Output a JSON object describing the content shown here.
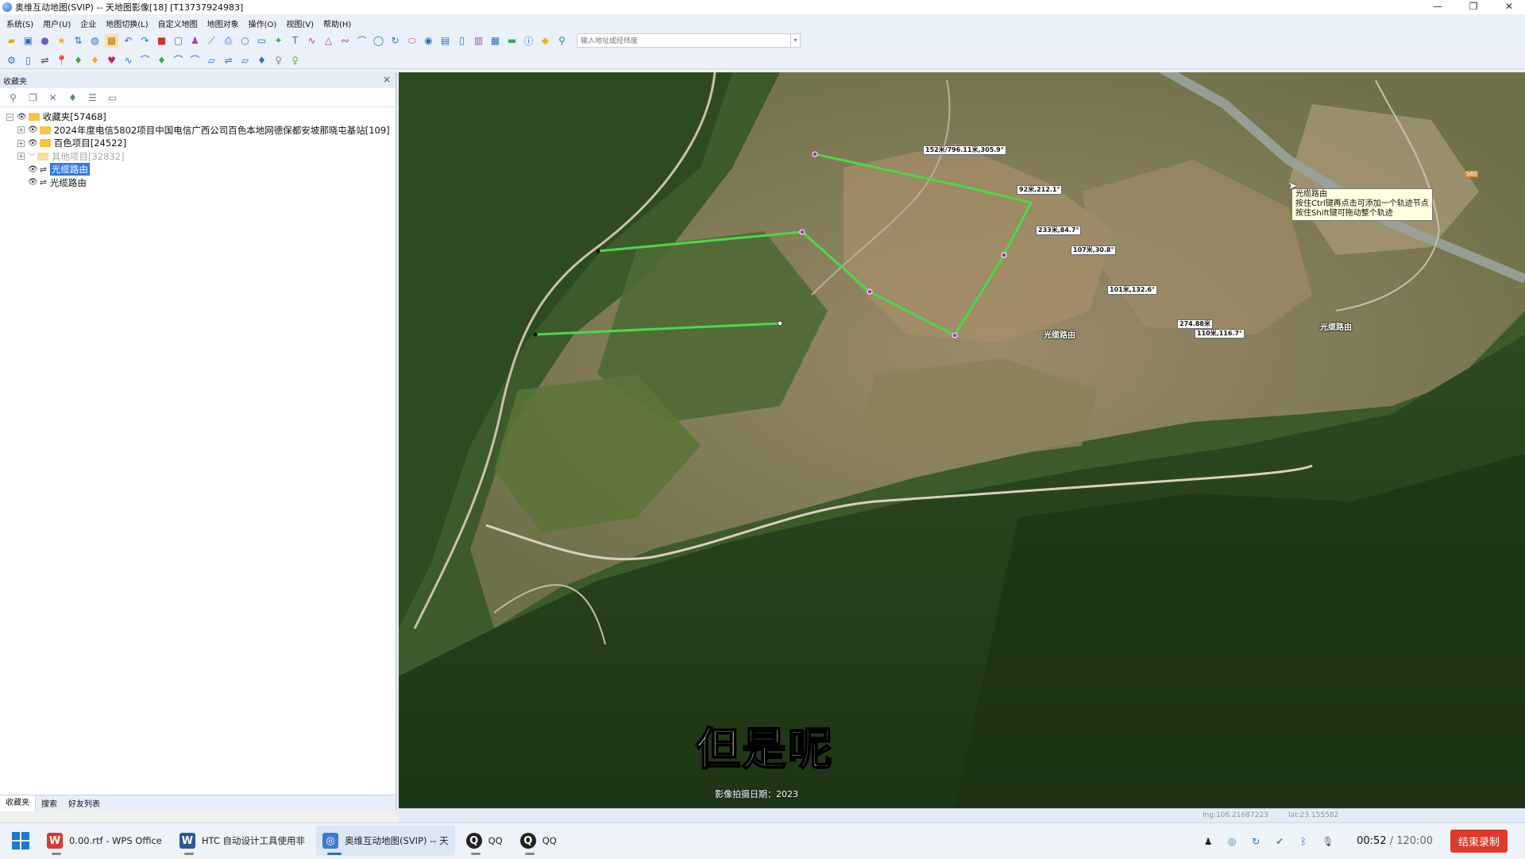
{
  "window": {
    "title": "奥维互动地图(SVIP) -- 天地图影像[18] [T13737924983]",
    "controls": [
      "—",
      "❐",
      "✕"
    ]
  },
  "menu": [
    "系统(S)",
    "用户(U)",
    "企业",
    "地图切换(L)",
    "自定义地图",
    "地图对象",
    "操作(O)",
    "视图(V)",
    "帮助(H)"
  ],
  "toolbar": {
    "search_placeholder": "输入地址或经纬度"
  },
  "panel": {
    "title": "收藏夹",
    "close": "×",
    "tree": {
      "root": "收藏夹[57468]",
      "items": [
        {
          "label": "2024年度电信5802项目中国电信广西公司百色本地网德保都安坡那晓屯基站[109]",
          "type": "folder",
          "dim": false
        },
        {
          "label": "百色项目[24522]",
          "type": "folder",
          "dim": false
        },
        {
          "label": "其他项目[32832]",
          "type": "folder",
          "dim": true
        },
        {
          "label": "光缆路由",
          "type": "route",
          "selected": true
        },
        {
          "label": "光缆路由",
          "type": "route",
          "selected": false
        }
      ]
    },
    "tabs": [
      "收藏夹",
      "搜索",
      "好友列表"
    ]
  },
  "map": {
    "labels": [
      {
        "id": "l1",
        "text": "152米/796.11米,305.9°"
      },
      {
        "id": "l2",
        "text": "92米,212.1°"
      },
      {
        "id": "l3",
        "text": "233米,84.7°"
      },
      {
        "id": "l4",
        "text": "107米,30.8°"
      },
      {
        "id": "l5",
        "text": "101米,132.6°"
      },
      {
        "id": "l6",
        "text": "274.88米"
      },
      {
        "id": "l7",
        "text": "110米,116.7°"
      }
    ],
    "route_labels": [
      "光缆路由",
      "光缆路由"
    ],
    "tooltip": {
      "title": "光缆路由",
      "line1": "按住Ctrl键再点击可添加一个轨迹节点",
      "line2": "按住Shift键可拖动整个轨迹"
    },
    "shield": "S60",
    "subtitle": "但是呢",
    "image_date": "影像拍摄日期：2023"
  },
  "status": {
    "lng": "lng:106.21687223",
    "lat": "lat:23.155582"
  },
  "taskbar": {
    "apps": [
      {
        "label": "0.00.rtf - WPS Office",
        "icon": "W",
        "color": "#d93a2b"
      },
      {
        "label": "HTC 自动设计工具使用非",
        "icon": "W",
        "color": "#2b579a"
      },
      {
        "label": "奥维互动地图(SVIP) -- 天",
        "icon": "◎",
        "color": "#3a7bd5"
      },
      {
        "label": "QQ",
        "icon": "Q",
        "color": "#222"
      },
      {
        "label": "QQ",
        "icon": "Q",
        "color": "#222"
      }
    ],
    "record_time": "00:52",
    "record_total": "/ 120:00",
    "record_stop": "结束录制"
  },
  "colors": {
    "route_line": "#4bd84b",
    "selection": "#2f7ae5",
    "stop_button": "#e03a2c"
  }
}
